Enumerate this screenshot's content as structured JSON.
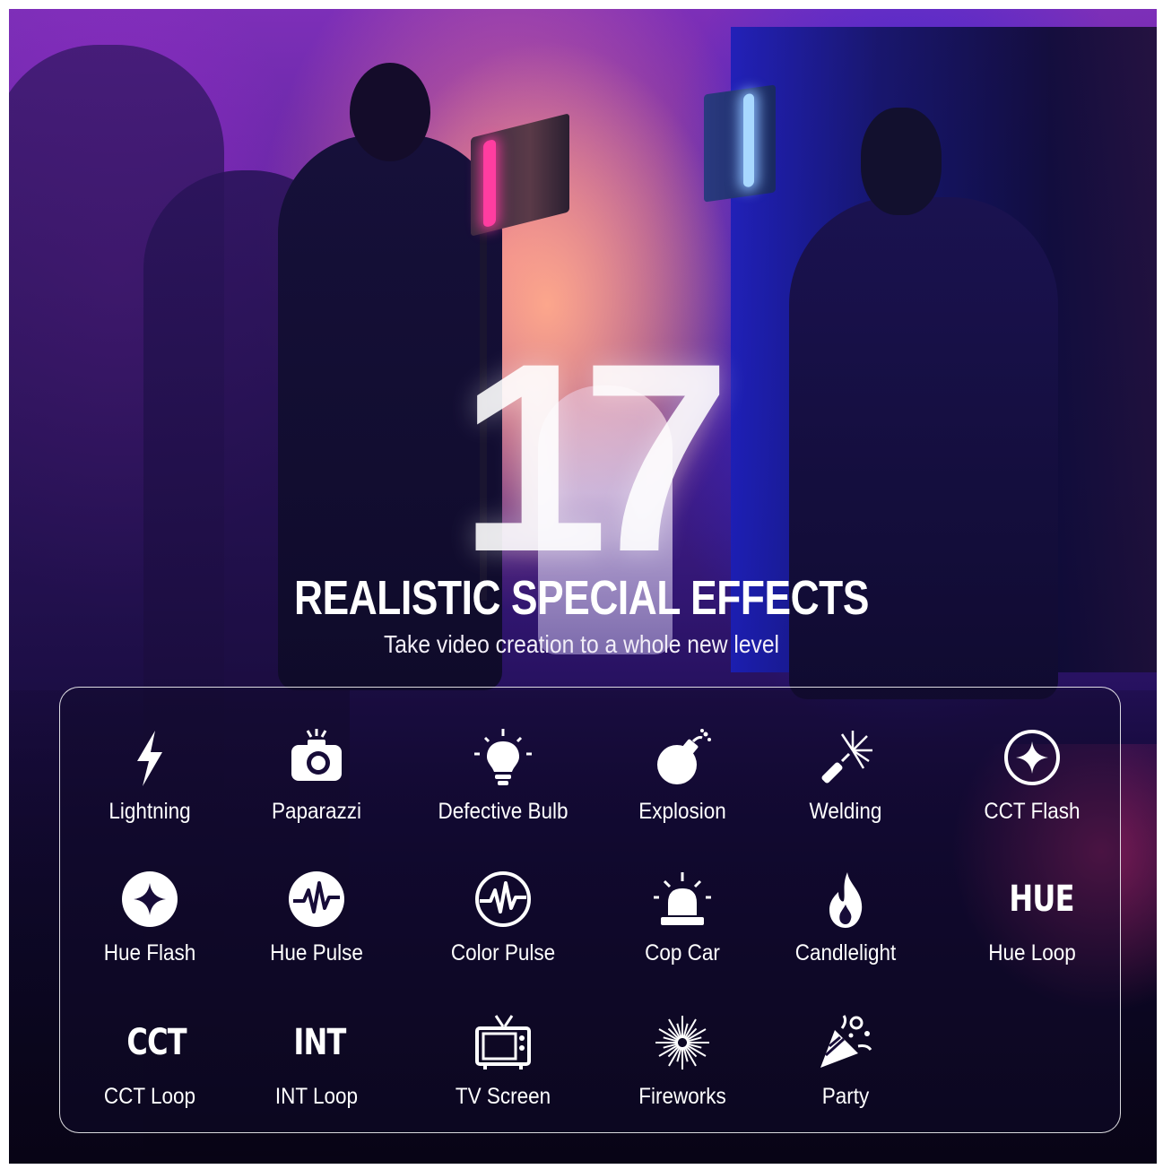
{
  "hero": {
    "number": "17",
    "headline": "REALISTIC SPECIAL EFFECTS",
    "subline": "Take video creation to a whole new level"
  },
  "effects": [
    {
      "label": "Lightning",
      "icon": "lightning-icon"
    },
    {
      "label": "Paparazzi",
      "icon": "camera-icon"
    },
    {
      "label": "Defective Bulb",
      "icon": "bulb-icon"
    },
    {
      "label": "Explosion",
      "icon": "bomb-icon"
    },
    {
      "label": "Welding",
      "icon": "welding-sparks-icon"
    },
    {
      "label": "CCT Flash",
      "icon": "sparkle-circle-outline-icon"
    },
    {
      "label": "Hue Flash",
      "icon": "sparkle-circle-filled-icon"
    },
    {
      "label": "Hue Pulse",
      "icon": "pulse-circle-filled-icon"
    },
    {
      "label": "Color Pulse",
      "icon": "pulse-circle-outline-icon"
    },
    {
      "label": "Cop Car",
      "icon": "siren-icon"
    },
    {
      "label": "Candlelight",
      "icon": "flame-icon"
    },
    {
      "label": "Hue Loop",
      "icon": "hue-text-icon",
      "icon_text": "HUE"
    },
    {
      "label": "CCT Loop",
      "icon": "cct-text-icon",
      "icon_text": "CCT"
    },
    {
      "label": "INT Loop",
      "icon": "int-text-icon",
      "icon_text": "INT"
    },
    {
      "label": "TV Screen",
      "icon": "tv-icon"
    },
    {
      "label": "Fireworks",
      "icon": "fireworks-icon"
    },
    {
      "label": "Party",
      "icon": "party-popper-icon"
    }
  ],
  "colors": {
    "text": "#ffffff",
    "pink_light": "#ff3da0",
    "blue_light": "#1a1fb8",
    "background_dark": "#0c0724"
  }
}
